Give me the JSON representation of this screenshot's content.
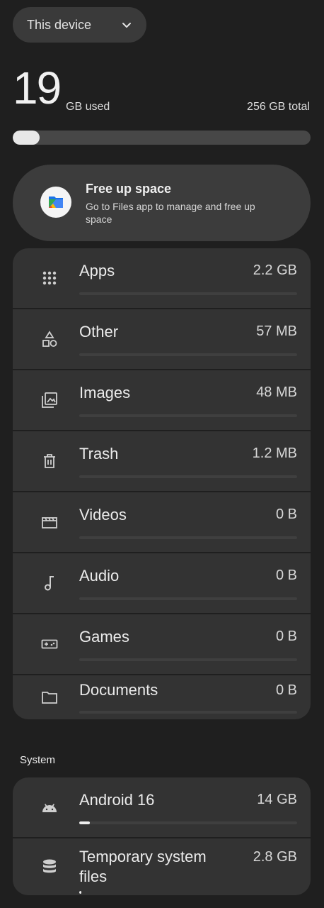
{
  "device_select": {
    "label": "This device"
  },
  "storage": {
    "used_value": "19",
    "used_unit": "GB used",
    "total": "256 GB total",
    "used_fraction": 0.09
  },
  "free_up": {
    "title": "Free up space",
    "subtitle": "Go to Files app to manage and free up space"
  },
  "categories": [
    {
      "name": "Apps",
      "size": "2.2 GB",
      "icon": "apps-grid-icon",
      "fraction": 0
    },
    {
      "name": "Other",
      "size": "57 MB",
      "icon": "shapes-icon",
      "fraction": 0
    },
    {
      "name": "Images",
      "size": "48 MB",
      "icon": "images-icon",
      "fraction": 0
    },
    {
      "name": "Trash",
      "size": "1.2 MB",
      "icon": "trash-icon",
      "fraction": 0
    },
    {
      "name": "Videos",
      "size": "0 B",
      "icon": "movie-icon",
      "fraction": 0
    },
    {
      "name": "Audio",
      "size": "0 B",
      "icon": "music-note-icon",
      "fraction": 0
    },
    {
      "name": "Games",
      "size": "0 B",
      "icon": "gamepad-icon",
      "fraction": 0
    },
    {
      "name": "Documents",
      "size": "0 B",
      "icon": "folder-icon",
      "fraction": 0
    }
  ],
  "system": {
    "label": "System",
    "items": [
      {
        "name": "Android 16",
        "size": "14 GB",
        "icon": "android-icon",
        "fraction": 0.05
      },
      {
        "name": "Temporary system files",
        "size": "2.8 GB",
        "icon": "database-icon",
        "fraction": 0.01
      }
    ]
  },
  "colors": {
    "background": "#1f1f1f",
    "card": "#333333",
    "accent_fill": "#e8e8e8"
  }
}
